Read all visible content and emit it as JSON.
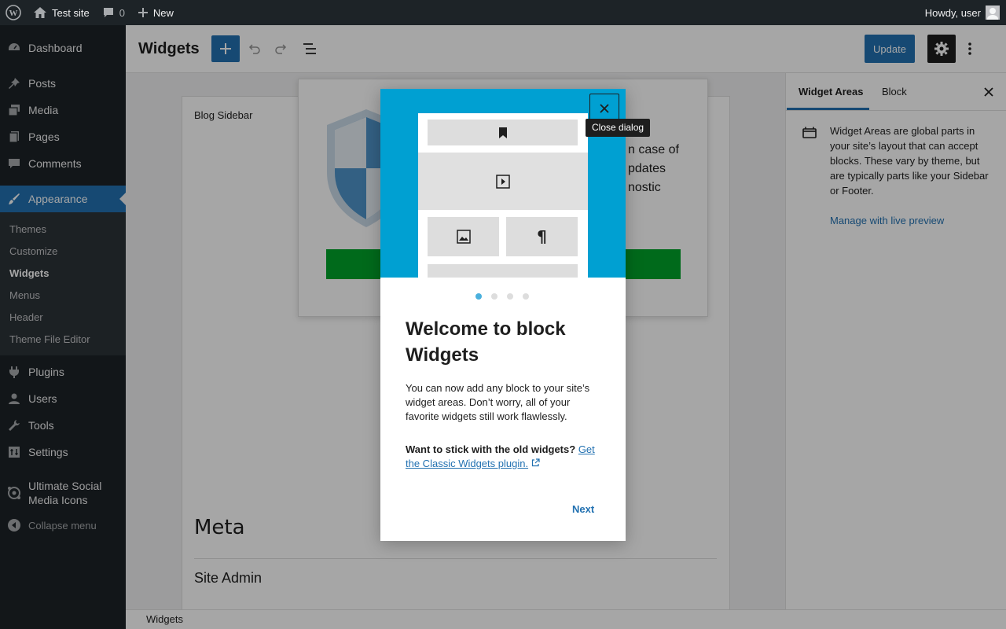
{
  "adminbar": {
    "site_name": "Test site",
    "comments_count": "0",
    "new_label": "New",
    "howdy": "Howdy, user"
  },
  "sidebar": {
    "items": [
      {
        "label": "Dashboard",
        "icon": "dashboard-icon"
      },
      {
        "label": "Posts",
        "icon": "pin-icon"
      },
      {
        "label": "Media",
        "icon": "media-icon"
      },
      {
        "label": "Pages",
        "icon": "pages-icon"
      },
      {
        "label": "Comments",
        "icon": "comment-icon"
      },
      {
        "label": "Appearance",
        "icon": "brush-icon"
      },
      {
        "label": "Plugins",
        "icon": "plug-icon"
      },
      {
        "label": "Users",
        "icon": "users-icon"
      },
      {
        "label": "Tools",
        "icon": "wrench-icon"
      },
      {
        "label": "Settings",
        "icon": "settings-icon"
      },
      {
        "label": "Ultimate Social Media Icons",
        "icon": "social-icon"
      },
      {
        "label": "Collapse menu",
        "icon": "collapse-icon"
      }
    ],
    "appearance_submenu": [
      "Themes",
      "Customize",
      "Widgets",
      "Menus",
      "Header",
      "Theme File Editor"
    ]
  },
  "header": {
    "title": "Widgets",
    "update_label": "Update"
  },
  "canvas": {
    "widget_area_title": "Blog Sidebar",
    "meta_heading": "Meta",
    "site_admin": "Site Admin"
  },
  "bg_modal": {
    "text_line1": "n case of",
    "text_line2": "pdates",
    "text_line3": "nostic"
  },
  "right_panel": {
    "tab_widget_areas": "Widget Areas",
    "tab_block": "Block",
    "description": "Widget Areas are global parts in your site’s layout that can accept blocks. These vary by theme, but are typically parts like your Sidebar or Footer.",
    "link": "Manage with live preview"
  },
  "footer": {
    "breadcrumb": "Widgets"
  },
  "guide": {
    "close_tooltip": "Close dialog",
    "heading": "Welcome to block Widgets",
    "body": "You can now add any block to your site’s widget areas. Don’t worry, all of your favorite widgets still work flawlessly.",
    "old_widgets_prompt": "Want to stick with the old widgets?",
    "classic_link": "Get the Classic Widgets plugin.",
    "next_label": "Next",
    "page_count": 4,
    "current_page": 1
  },
  "colors": {
    "admin_dark": "#1d2327",
    "accent": "#2271b1",
    "hero_blue": "#00a0d2",
    "green": "#00a32a"
  }
}
